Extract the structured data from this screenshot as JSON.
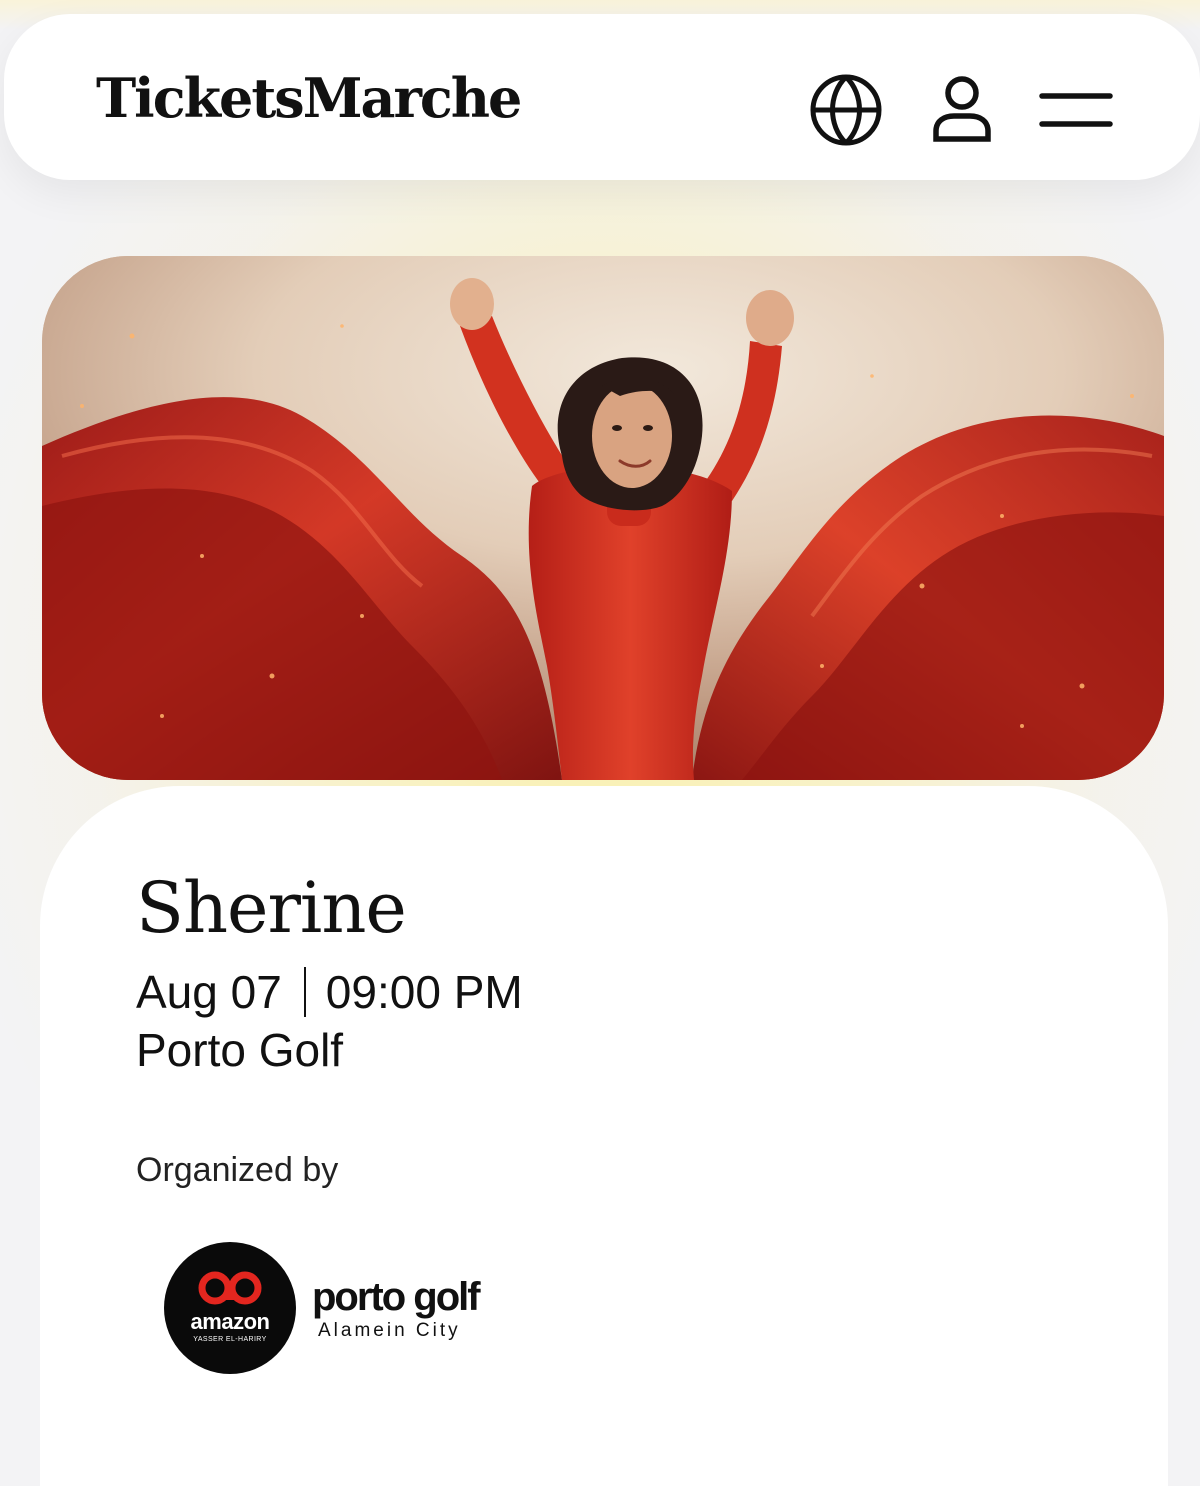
{
  "header": {
    "logo": "TicketsMarche",
    "icons": [
      "globe-icon",
      "user-icon",
      "menu-icon"
    ]
  },
  "event": {
    "title": "Sherine",
    "date": "Aug 07",
    "time": "09:00 PM",
    "venue": "Porto Golf",
    "organized_by_label": "Organized by"
  },
  "organizers": {
    "amazon": {
      "name": "amazon",
      "subtitle": "YASSER EL-HARIRY"
    },
    "porto_golf": {
      "name": "porto golf",
      "subtitle": "Alamein City"
    }
  },
  "colors": {
    "background": "#f3f3f5",
    "accent_glow": "#faf0aa",
    "hero_red": "#c8231d",
    "brand_red": "#e3261f",
    "text": "#111111"
  }
}
